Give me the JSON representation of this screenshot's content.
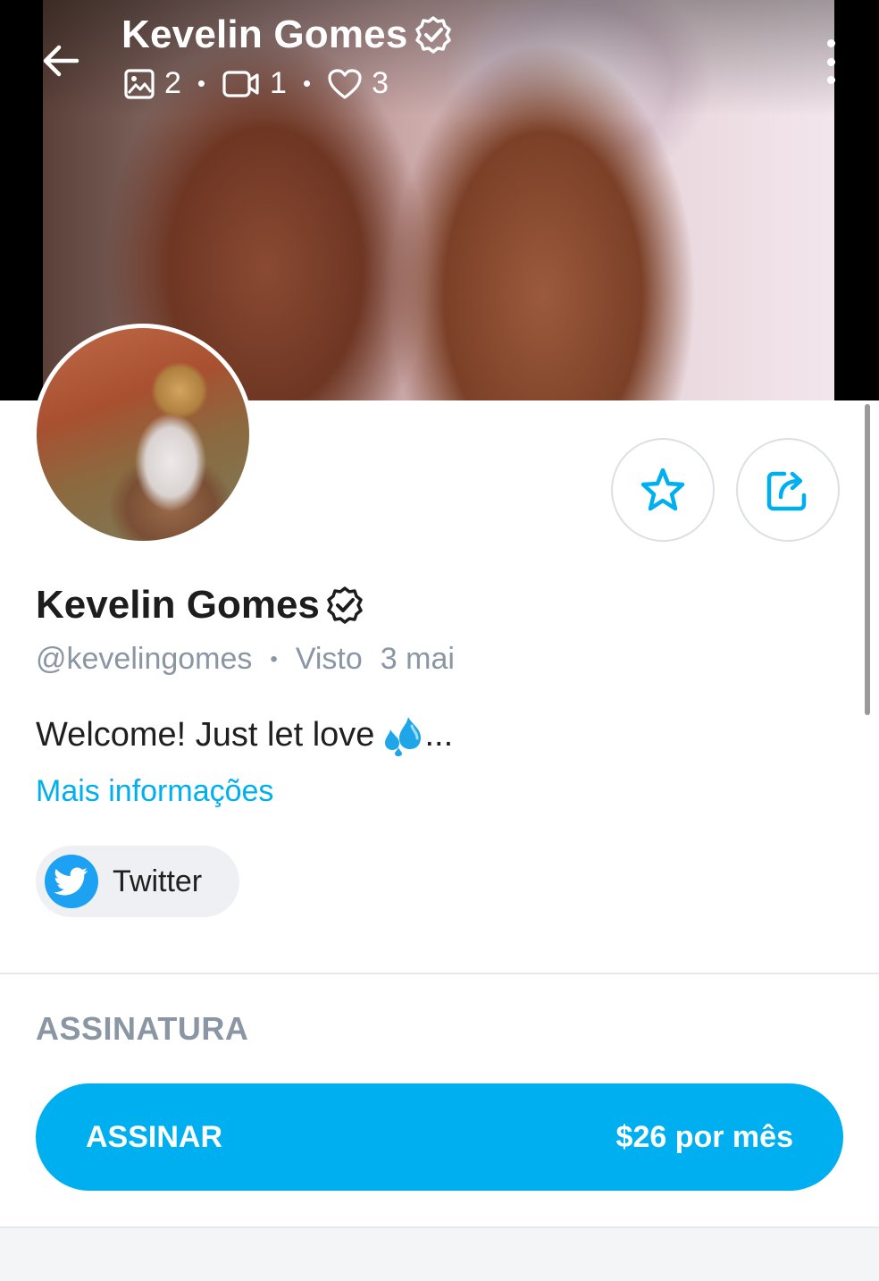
{
  "header": {
    "title": "Kevelin Gomes",
    "photos_count": "2",
    "videos_count": "1",
    "likes_count": "3"
  },
  "profile": {
    "name": "Kevelin Gomes",
    "handle": "@kevelingomes",
    "seen_label": "Visto",
    "seen_date": "3 mai",
    "bio": "Welcome! Just let love",
    "bio_ellipsis": "...",
    "more_info": "Mais informações"
  },
  "social": {
    "twitter_label": "Twitter"
  },
  "subscription": {
    "section_title": "ASSINATURA",
    "button_label": "ASSINAR",
    "price": "$26 por mês"
  },
  "colors": {
    "accent": "#00aff0",
    "twitter": "#1da1f2",
    "muted": "#8a96a3"
  },
  "icons": [
    "back-arrow-icon",
    "verified-badge-icon",
    "photo-icon",
    "video-icon",
    "heart-icon",
    "more-vertical-icon",
    "star-icon",
    "share-icon",
    "twitter-bird-icon",
    "droplets-emoji-icon"
  ]
}
